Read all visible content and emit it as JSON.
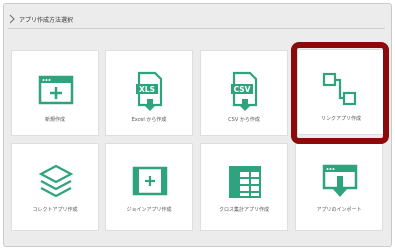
{
  "header": {
    "title": "アプリ作成方法選択"
  },
  "tiles": [
    {
      "label": "新規作成",
      "icon": "new-window-icon"
    },
    {
      "label": "Excel から作成",
      "icon": "xls-file-icon",
      "badge": "XLS"
    },
    {
      "label": "CSV から作成",
      "icon": "csv-file-icon",
      "badge": "CSV"
    },
    {
      "label": "リンクアプリ作成",
      "icon": "link-squares-icon"
    },
    {
      "label": "コレクトアプリ作成",
      "icon": "layers-icon"
    },
    {
      "label": "ジョインアプリ作成",
      "icon": "join-window-icon"
    },
    {
      "label": "クロス集計アプリ作成",
      "icon": "crosstab-table-icon"
    },
    {
      "label": "アプリのインポート",
      "icon": "import-window-icon"
    }
  ],
  "colors": {
    "accent": "#2fa37d",
    "highlight": "#8b0a0a",
    "background": "#ececec"
  }
}
